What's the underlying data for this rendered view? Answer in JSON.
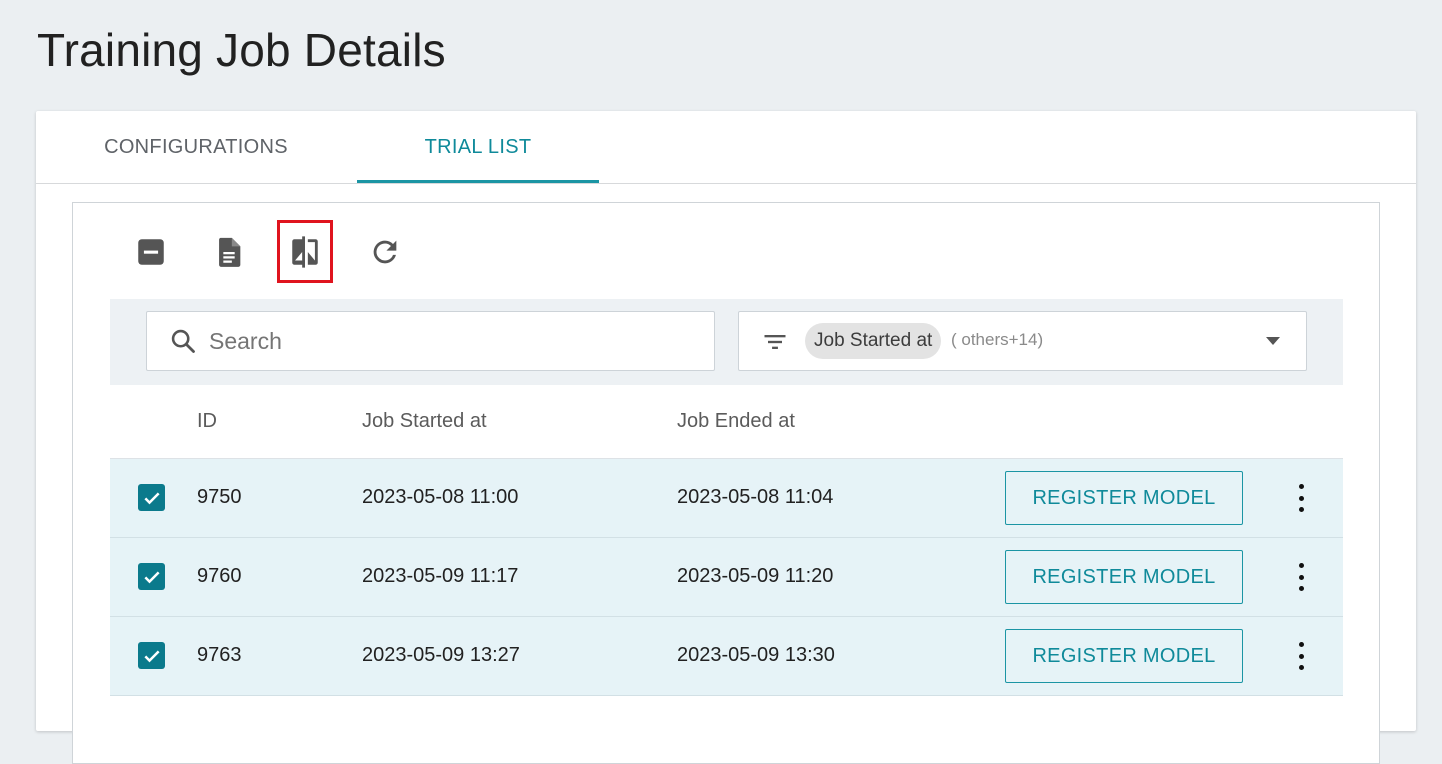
{
  "page": {
    "title": "Training Job Details"
  },
  "tabs": [
    {
      "label": "CONFIGURATIONS",
      "active": false
    },
    {
      "label": "TRIAL LIST",
      "active": true
    }
  ],
  "toolbar": {
    "icons": [
      "collapse-icon",
      "report-icon",
      "compare-icon",
      "refresh-icon"
    ],
    "highlighted": "compare-icon",
    "highlight_color": "#e0141e"
  },
  "search": {
    "placeholder": "Search",
    "value": ""
  },
  "column_select": {
    "chip": "Job Started at",
    "others": "( others+14)"
  },
  "table": {
    "headers": {
      "id": "ID",
      "started": "Job Started at",
      "ended": "Job Ended at"
    },
    "rows": [
      {
        "id": "9750",
        "started": "2023-05-08 11:00",
        "ended": "2023-05-08 11:04",
        "checked": true,
        "action": "REGISTER MODEL"
      },
      {
        "id": "9760",
        "started": "2023-05-09 11:17",
        "ended": "2023-05-09 11:20",
        "checked": true,
        "action": "REGISTER MODEL"
      },
      {
        "id": "9763",
        "started": "2023-05-09 13:27",
        "ended": "2023-05-09 13:30",
        "checked": true,
        "action": "REGISTER MODEL"
      }
    ]
  },
  "colors": {
    "accent": "#1b95a4",
    "checkbox": "#0b7a8c",
    "selected_row": "#e6f3f7"
  }
}
